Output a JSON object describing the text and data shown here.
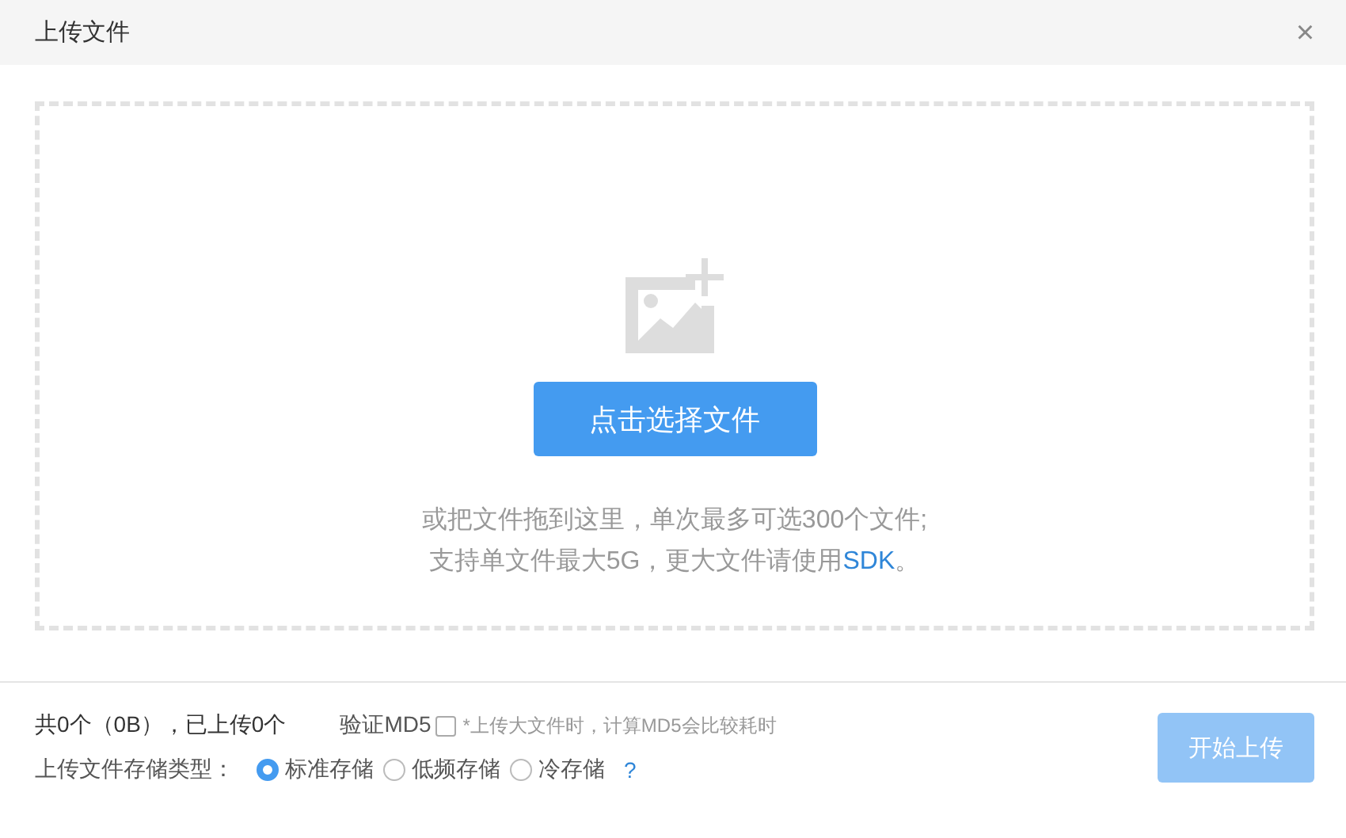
{
  "window": {
    "title": "上传文件",
    "close": "×"
  },
  "dropzone": {
    "button": "点击选择文件",
    "hint_line_1": "或把文件拖到这里，单次最多可选300个文件;",
    "hint_line_2": {
      "before": "支持单文件最大5G，更大文件请使用",
      "link": "SDK",
      "after": "。"
    }
  },
  "footer": {
    "summary": "共0个（0B），已上传0个",
    "md5": {
      "label": "验证MD5",
      "checked": false,
      "note": "*上传大文件时，计算MD5会比较耗时"
    },
    "storage": {
      "label": "上传文件存储类型：",
      "options": [
        {
          "label": "标准存储",
          "selected": true
        },
        {
          "label": "低频存储",
          "selected": false
        },
        {
          "label": "冷存储",
          "selected": false
        }
      ],
      "help": "?"
    },
    "upload_button": {
      "label": "开始上传",
      "disabled": true
    }
  }
}
